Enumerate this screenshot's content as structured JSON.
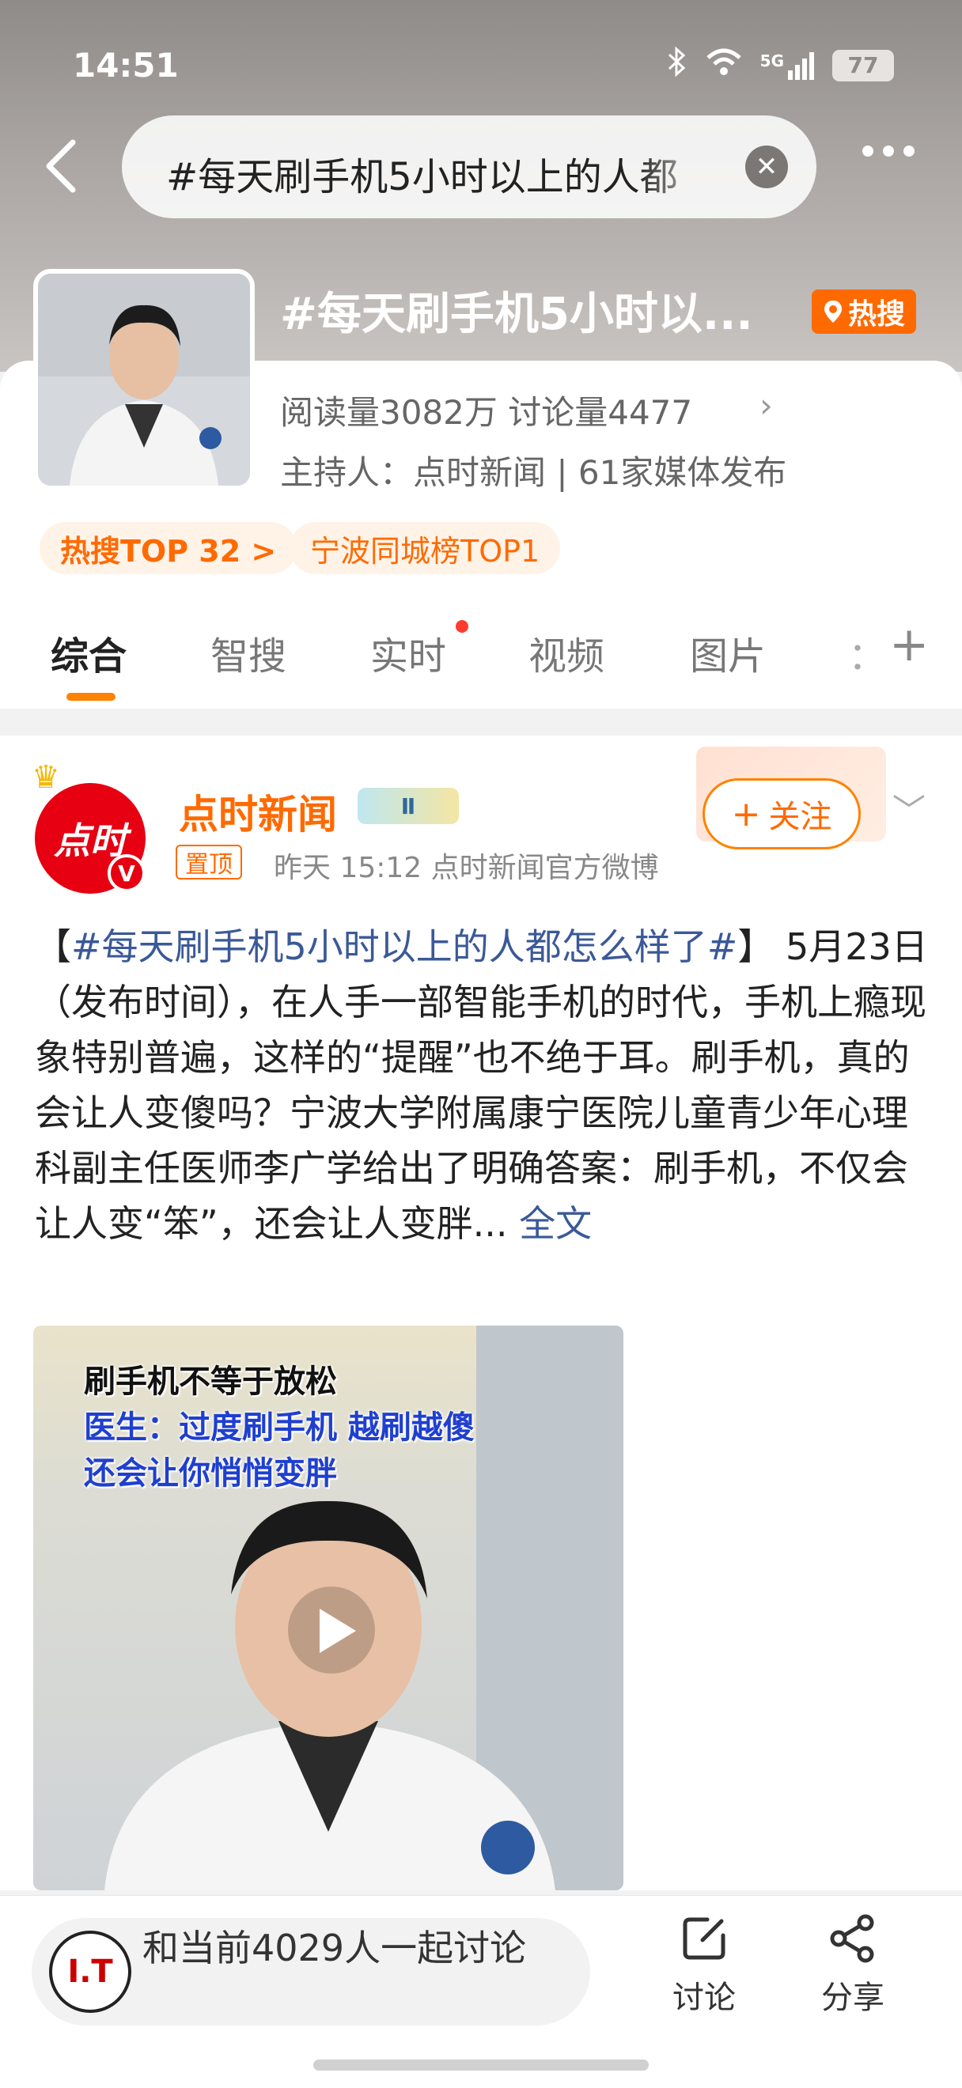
{
  "status_bar": {
    "time": "14:51",
    "network": "5G",
    "battery": "77"
  },
  "search": {
    "query": "#每天刷手机5小时以上的人都"
  },
  "topic": {
    "title": "#每天刷手机5小时以...",
    "hot_badge": "热搜",
    "stats": "阅读量3082万  讨论量4477",
    "host": "主持人：点时新闻 | 61家媒体发布",
    "chips": [
      "热搜TOP 32 >",
      "宁波同城榜TOP1"
    ]
  },
  "tabs": [
    "综合",
    "智搜",
    "实时",
    "视频",
    "图片",
    "："
  ],
  "post": {
    "author": "点时新闻",
    "avatar_text": "点时",
    "level_badge": "Ⅱ",
    "pinned": "置顶",
    "meta": "昨天 15:12   点时新闻官方微博",
    "follow": "关注",
    "text_open": "【",
    "text_tag": "#每天刷手机5小时以上的人都怎么样了#",
    "text_body": "】 5月23日（发布时间），在人手一部智能手机的时代，手机上瘾现象特别普遍，这样的“提醒”也不绝于耳。刷手机，真的会让人变傻吗？宁波大学附属康宁医院儿童青少年心理科副主任医师李广学给出了明确答案：刷手机，不仅会让人变“笨”，还会让人变胖...",
    "full_text_link": "全文",
    "video_captions": [
      "刷手机不等于放松",
      "医生：过度刷手机 越刷越傻",
      "还会让你悄悄变胖"
    ]
  },
  "bottom_bar": {
    "logo_text": "I.T",
    "discuss_prompt": "和当前4029人一起讨论",
    "discuss_label": "讨论",
    "share_label": "分享"
  },
  "colors": {
    "accent": "#ff8200",
    "hot": "#ff6a00",
    "link": "#3b5998",
    "brand_red": "#e60012"
  }
}
